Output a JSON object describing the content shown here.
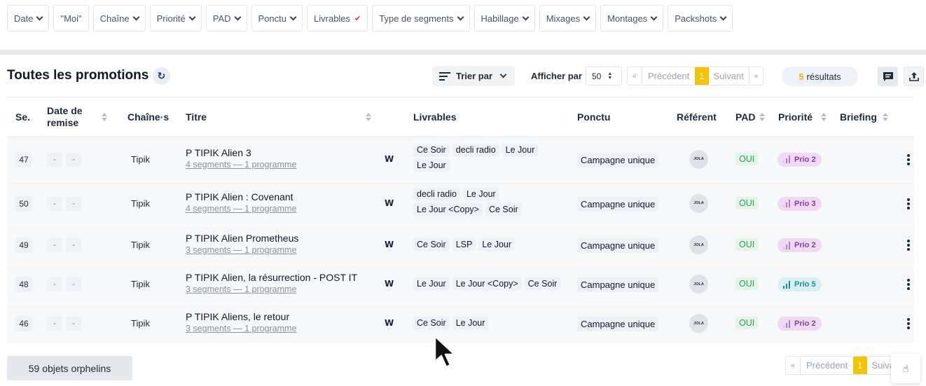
{
  "filters": [
    {
      "label": "Date",
      "icon": "chevron-down-icon"
    },
    {
      "label": "\"Moi\"",
      "icon": ""
    },
    {
      "label": "Chaîne",
      "icon": "chevron-down-icon"
    },
    {
      "label": "Priorité",
      "icon": "chevron-down-icon"
    },
    {
      "label": "PAD",
      "icon": "chevron-down-icon"
    },
    {
      "label": "Ponctu",
      "icon": "chevron-down-icon"
    },
    {
      "label": "Livrables",
      "icon": "flag-icon"
    },
    {
      "label": "Type de segments",
      "icon": "chevron-down-icon"
    },
    {
      "label": "Habillage",
      "icon": "chevron-down-icon"
    },
    {
      "label": "Mixages",
      "icon": "chevron-down-icon"
    },
    {
      "label": "Montages",
      "icon": "chevron-down-icon"
    },
    {
      "label": "Packshots",
      "icon": "chevron-down-icon"
    }
  ],
  "toolbar": {
    "title": "Toutes les promotions",
    "sort_label": "Trier par",
    "per_page_label": "Afficher par",
    "per_page_value": "50",
    "pager": {
      "first": "«",
      "prev": "Précédent",
      "current": "1",
      "next": "Suivant",
      "last": "»"
    },
    "results_count": "5",
    "results_label": "résultats"
  },
  "columns": {
    "num": "Se.",
    "date": "Date de remise",
    "chaine": "Chaîne·s",
    "titre": "Titre",
    "livrables": "Livrables",
    "ponctu": "Ponctu",
    "referent": "Référent",
    "pad": "PAD",
    "priorite": "Priorité",
    "briefing": "Briefing"
  },
  "rows": [
    {
      "num": "47",
      "date_a": "-",
      "date_b": "-",
      "chaine": "Tipik",
      "title": "P TIPIK Alien 3",
      "sub": "4 segments — 1 programme",
      "w": "W",
      "livrables": [
        "Ce Soir",
        "decli radio",
        "Le Jour",
        "Le Jour"
      ],
      "ponctu": "Campagne unique",
      "referent": "JOLA",
      "pad": "OUI",
      "prio": "Prio 2",
      "prio_level": 2
    },
    {
      "num": "50",
      "date_a": "-",
      "date_b": "-",
      "chaine": "Tipik",
      "title": "P TIPIK Alien : Covenant",
      "sub": "4 segments — 1 programme",
      "w": "W",
      "livrables": [
        "decli radio",
        "Le Jour",
        "Le Jour <Copy>",
        "Ce Soir"
      ],
      "ponctu": "Campagne unique",
      "referent": "JOLA",
      "pad": "OUI",
      "prio": "Prio 3",
      "prio_level": 3
    },
    {
      "num": "49",
      "date_a": "-",
      "date_b": "-",
      "chaine": "Tipik",
      "title": "P TIPIK Alien Prometheus",
      "sub": "3 segments — 1 programme",
      "w": "W",
      "livrables": [
        "Ce Soir",
        "LSP",
        "Le Jour"
      ],
      "ponctu": "Campagne unique",
      "referent": "JOLA",
      "pad": "OUI",
      "prio": "Prio 2",
      "prio_level": 2
    },
    {
      "num": "48",
      "date_a": "-",
      "date_b": "-",
      "chaine": "Tipik",
      "title": "P TIPIK Alien, la résurrection - POST IT",
      "sub": "3 segments — 1 programme",
      "w": "W",
      "livrables": [
        "Le Jour",
        "Le Jour <Copy>",
        "Ce Soir"
      ],
      "ponctu": "Campagne unique",
      "referent": "JOLA",
      "pad": "OUI",
      "prio": "Prio 5",
      "prio_level": 5
    },
    {
      "num": "46",
      "date_a": "-",
      "date_b": "-",
      "chaine": "Tipik",
      "title": "P TIPIK Aliens, le retour",
      "sub": "3 segments — 1 programme",
      "w": "W",
      "livrables": [
        "Ce Soir",
        "Le Jour"
      ],
      "ponctu": "Campagne unique",
      "referent": "JOLA",
      "pad": "OUI",
      "prio": "Prio 2",
      "prio_level": 2
    }
  ],
  "footer": {
    "orphans_label": "59 objets orphelins",
    "pager": {
      "first": "«",
      "prev": "Précédent",
      "current": "1",
      "next": "Suivant"
    }
  },
  "colors": {
    "accent": "#f7c300",
    "prio_purple": "#8b3aa8",
    "prio_teal": "#1e8aa0",
    "pad_green": "#2f9e5b"
  }
}
